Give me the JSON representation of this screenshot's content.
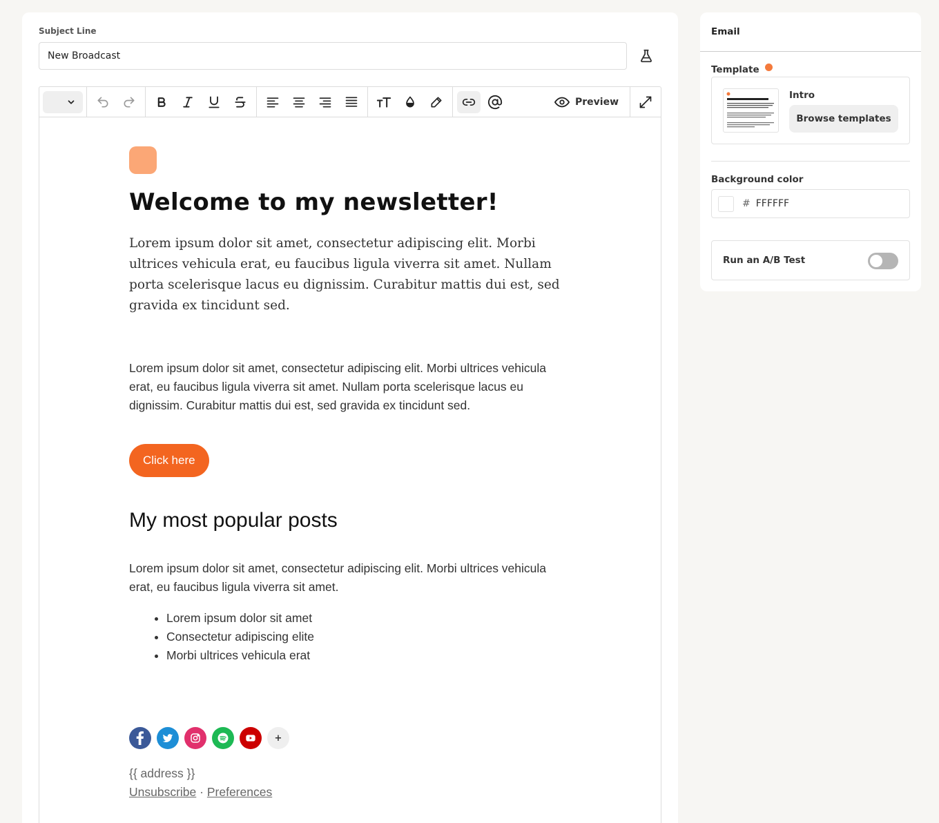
{
  "subject": {
    "label": "Subject Line",
    "value": "New Broadcast"
  },
  "toolbar": {
    "preview_label": "Preview"
  },
  "email": {
    "title": "Welcome to my newsletter!",
    "intro_paragraph": "Lorem ipsum dolor sit amet, consectetur adipiscing elit. Morbi ultrices vehicula erat, eu faucibus ligula viverra sit amet. Nullam porta scelerisque lacus eu dignissim. Curabitur mattis dui est, sed gravida ex tincidunt sed.",
    "body_paragraph": "Lorem ipsum dolor sit amet, consectetur adipiscing elit. Morbi ultrices vehicula erat, eu faucibus ligula viverra sit amet. Nullam porta scelerisque lacus eu dignissim. Curabitur mattis dui est, sed gravida ex tincidunt sed.",
    "cta_label": "Click here",
    "section_heading": "My most popular posts",
    "section_paragraph": "Lorem ipsum dolor sit amet, consectetur adipiscing elit. Morbi ultrices vehicula erat, eu faucibus ligula viverra sit amet.",
    "bullets": [
      "Lorem ipsum dolor sit amet",
      "Consectetur adipiscing elite",
      "Morbi ultrices vehicula erat"
    ],
    "add_social_label": "+",
    "address": "{{ address }}",
    "unsubscribe": "Unsubscribe",
    "separator": "·",
    "preferences": "Preferences",
    "accent_color": "#f36520",
    "logo_color": "#fba776"
  },
  "sidebar": {
    "title": "Email",
    "template_label": "Template",
    "template_name": "Intro",
    "browse_label": "Browse templates",
    "bg_label": "Background color",
    "bg_hash": "#",
    "bg_value": "FFFFFF",
    "ab_label": "Run an A/B Test",
    "ab_enabled": false
  },
  "icons": {
    "socials": [
      "facebook-icon",
      "twitter-icon",
      "instagram-icon",
      "spotify-icon",
      "youtube-icon",
      "add-icon"
    ]
  }
}
